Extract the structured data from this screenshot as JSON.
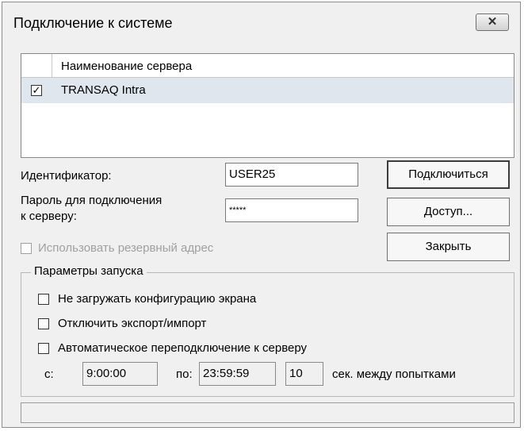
{
  "window": {
    "title": "Подключение к системе",
    "close_symbol": "✕"
  },
  "server_list": {
    "header": "Наименование сервера",
    "rows": [
      {
        "checked": true,
        "name": "TRANSAQ Intra"
      }
    ]
  },
  "form": {
    "id_label": "Идентификатор:",
    "id_value": "USER25",
    "password_label_line1": "Пароль для подключения",
    "password_label_line2": "к серверу:",
    "password_value": "*****",
    "reserve_label": "Использовать резервный адрес",
    "reserve_checked": false
  },
  "buttons": {
    "connect": "Подключиться",
    "access": "Доступ...",
    "close": "Закрыть"
  },
  "launch": {
    "title": "Параметры запуска",
    "opt1": "Не загружать конфигурацию экрана",
    "opt2": "Отключить экспорт/импорт",
    "opt3": "Автоматическое переподключение к серверу",
    "from_label": "с:",
    "from_value": "9:00:00",
    "to_label": "по:",
    "to_value": "23:59:59",
    "interval_value": "10",
    "interval_label": "сек. между попытками"
  },
  "status": {
    "text": ""
  }
}
